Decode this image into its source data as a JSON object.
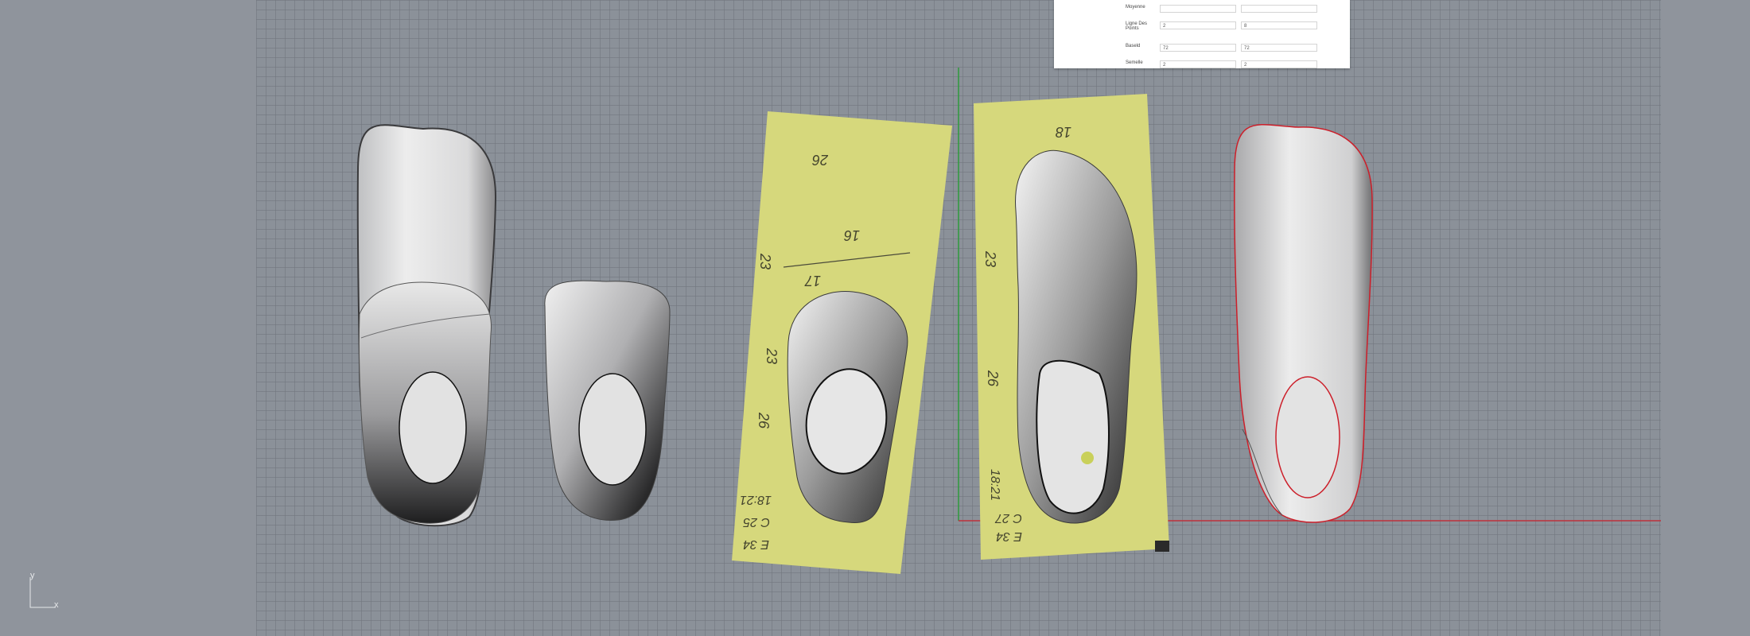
{
  "properties_panel": {
    "rows": [
      {
        "label": "Moyenne",
        "value_a": "",
        "value_b": ""
      },
      {
        "label": "Ligne Des Points",
        "value_a": "2",
        "value_b": "8"
      },
      {
        "label": "Baseld",
        "value_a": "72",
        "value_b": "72"
      },
      {
        "label": "Semelle",
        "value_a": "2",
        "value_b": "2"
      }
    ]
  },
  "scan_left": {
    "marks": [
      "26",
      "16",
      "17",
      "23",
      "23",
      "26",
      "E 34",
      "C 25",
      "18:21"
    ]
  },
  "scan_right": {
    "marks": [
      "18",
      "23",
      "26",
      "18:21",
      "E 34",
      "C 27"
    ]
  },
  "axis": {
    "y_label": "y",
    "x_label": "x"
  },
  "colors": {
    "viewport_bg": "#8b9199",
    "grid_line": "#6e747c",
    "paper": "#d6d87c",
    "x_axis": "#c0303a",
    "y_axis": "#2e9a3c",
    "selection": "#cc1f2a"
  },
  "icons": [
    "axis-gizmo-icon"
  ]
}
